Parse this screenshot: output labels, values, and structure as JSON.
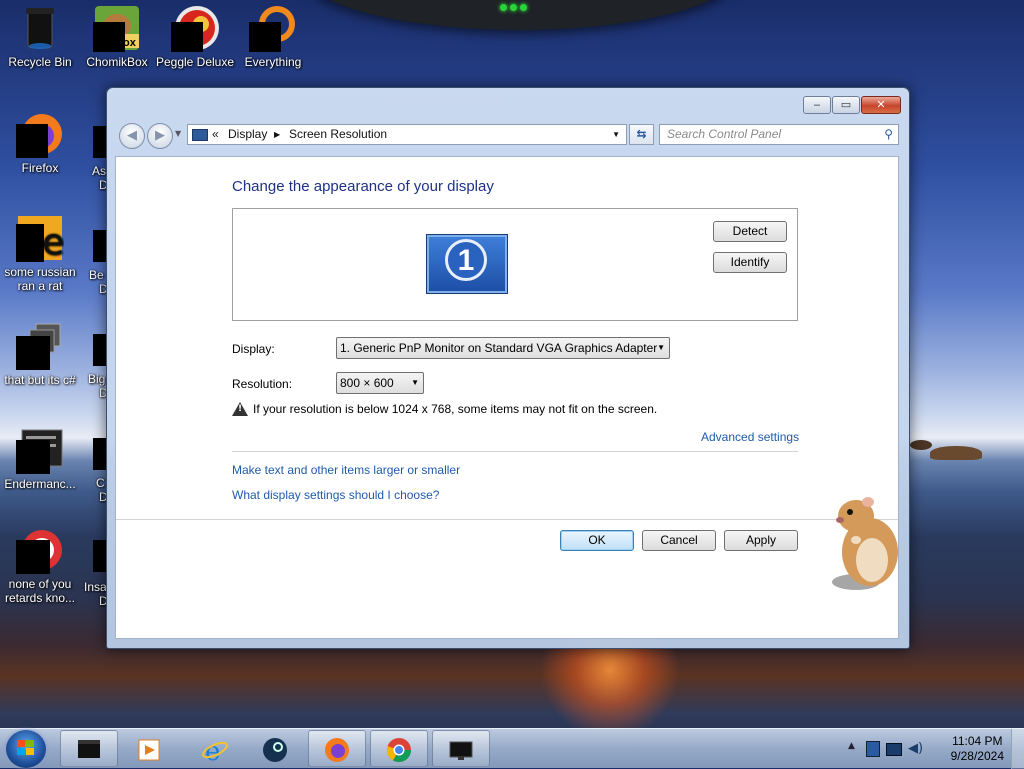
{
  "desktop": {
    "icons": [
      {
        "label": "Recycle Bin"
      },
      {
        "label": "ChomikBox"
      },
      {
        "label": "Peggle Deluxe"
      },
      {
        "label": "Everything"
      },
      {
        "label": "Firefox"
      },
      {
        "label": "some russian ran a rat"
      },
      {
        "label": "that but its c#"
      },
      {
        "label": "Endermanc..."
      },
      {
        "label": "none of you retards kno..."
      }
    ],
    "partial_labels": [
      "As",
      "D",
      "Be",
      "D",
      "Big",
      "D",
      "C",
      "D",
      "Insa",
      "D"
    ],
    "icon_badge_text": "ox"
  },
  "window": {
    "caption_buttons": {
      "minimize": "‒",
      "maximize": "▭",
      "close": "✕"
    },
    "nav": {
      "back": "◀",
      "forward": "▶"
    },
    "breadcrumb": {
      "chevrons": "«",
      "items": [
        "Display",
        "Screen Resolution"
      ]
    },
    "search_placeholder": "Search Control Panel",
    "heading": "Change the appearance of your display",
    "monitor_number": "1",
    "detect_label": "Detect",
    "identify_label": "Identify",
    "display_label": "Display:",
    "display_value": "1. Generic PnP Monitor on Standard VGA Graphics Adapter",
    "resolution_label": "Resolution:",
    "resolution_value": "800 × 600",
    "warning_text": "If your resolution is below 1024 x 768, some items may not fit on the screen.",
    "advanced_link": "Advanced settings",
    "link_text_size": "Make text and other items larger or smaller",
    "link_which_settings": "What display settings should I choose?",
    "ok_label": "OK",
    "cancel_label": "Cancel",
    "apply_label": "Apply"
  },
  "taskbar": {
    "pinned": [
      "start",
      "cmd",
      "media-player",
      "internet-explorer",
      "steam",
      "firefox",
      "chrome",
      "display-settings"
    ],
    "time": "11:04 PM",
    "date": "9/28/2024",
    "tray_arrow": "▲"
  }
}
